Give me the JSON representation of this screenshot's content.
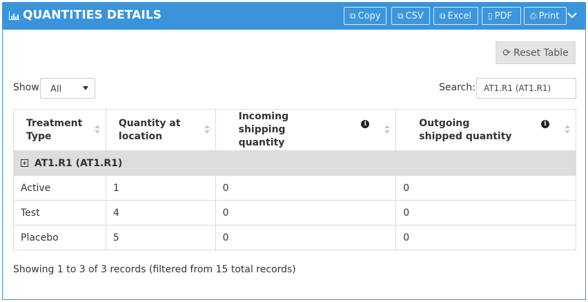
{
  "header": {
    "title": "QUANTITIES DETAILS",
    "buttons": {
      "copy": "Copy",
      "csv": "CSV",
      "excel": "Excel",
      "pdf": "PDF",
      "print": "Print"
    },
    "color": "#3a94dc"
  },
  "toolbar": {
    "reset_label": "Reset Table"
  },
  "length_control": {
    "label": "Show",
    "selected": "All"
  },
  "search": {
    "label": "Search:",
    "value": "AT1.R1 (AT1.R1)"
  },
  "table": {
    "columns": [
      {
        "label": "Treatment Type"
      },
      {
        "label": "Quantity at location"
      },
      {
        "label": "Incoming shipping quantity",
        "info": "i"
      },
      {
        "label": "Outgoing shipped quantity",
        "info": "i"
      }
    ],
    "group": {
      "label": "AT1.R1 (AT1.R1)"
    },
    "rows": [
      {
        "type": "Active",
        "qty": "1",
        "incoming": "0",
        "outgoing": "0"
      },
      {
        "type": "Test",
        "qty": "4",
        "incoming": "0",
        "outgoing": "0"
      },
      {
        "type": "Placebo",
        "qty": "5",
        "incoming": "0",
        "outgoing": "0"
      }
    ]
  },
  "footer": {
    "info": "Showing 1 to 3 of 3 records (filtered from 15 total records)"
  }
}
